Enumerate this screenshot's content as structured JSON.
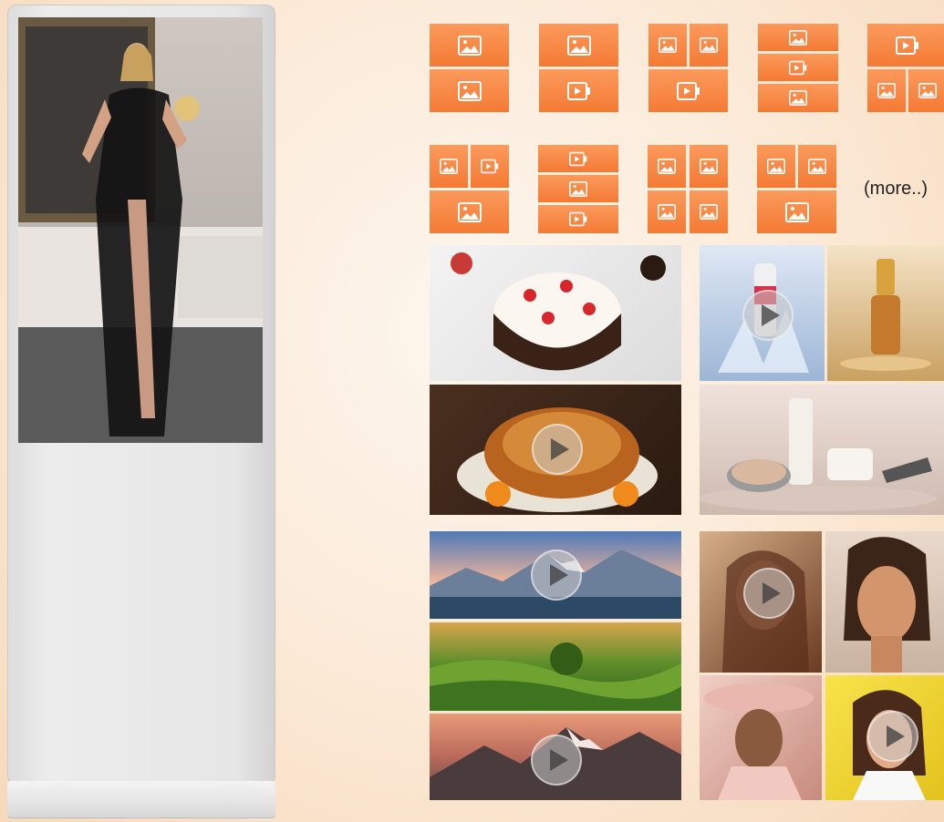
{
  "more_label": "(more..)",
  "icons": {
    "image": "image-icon",
    "video": "video-icon",
    "play": "play-icon"
  },
  "colors": {
    "accent": "#f47a33",
    "accent_light": "#fb9a5c",
    "kiosk": "#e6e6e6"
  },
  "layouts": [
    {
      "name": "layout-2-image-stack",
      "cells": [
        "image",
        "image"
      ]
    },
    {
      "name": "layout-image-video-stack",
      "cells": [
        "image",
        "video"
      ]
    },
    {
      "name": "layout-2-image-over-video",
      "cells": [
        "image",
        "image",
        "video"
      ]
    },
    {
      "name": "layout-3-strip",
      "cells": [
        "image",
        "video",
        "image"
      ]
    },
    {
      "name": "layout-video-over-2-image",
      "cells": [
        "video",
        "image",
        "image"
      ]
    },
    {
      "name": "layout-image-video-over-image",
      "cells": [
        "image",
        "video",
        "image"
      ]
    },
    {
      "name": "layout-video-image-video-strip",
      "cells": [
        "video",
        "image",
        "video"
      ]
    },
    {
      "name": "layout-4-image-grid",
      "cells": [
        "image",
        "image",
        "image",
        "image"
      ]
    },
    {
      "name": "layout-2-image-over-image",
      "cells": [
        "image",
        "image",
        "image"
      ]
    }
  ]
}
